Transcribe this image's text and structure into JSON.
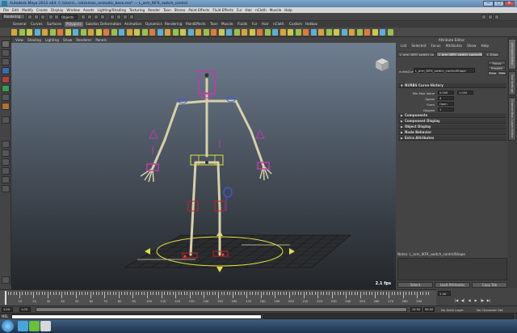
{
  "window": {
    "title": "Autodesk Maya 2012 x64: C:\\Users\\...\\stickman_animatic_base.ma* --- L_arm_IKFK_switch_control",
    "min_glyph": "—",
    "max_glyph": "□",
    "close_glyph": "✕"
  },
  "menubar": [
    "File",
    "Edit",
    "Modify",
    "Create",
    "Display",
    "Window",
    "Assets",
    "Lighting/Shading",
    "Texturing",
    "Render",
    "Toon",
    "Stereo",
    "Paint Effects",
    "Fluid Effects",
    "Fur",
    "Hair",
    "nCloth",
    "Muscle",
    "Help"
  ],
  "status_line": {
    "mode": "Rendering",
    "objects_field": "Objects"
  },
  "shelf": {
    "tabs": [
      "General",
      "Curves",
      "Surfaces",
      "Polygons",
      "Subdivs",
      "Deformation",
      "Animation",
      "Dynamics",
      "Rendering",
      "PaintEffects",
      "Toon",
      "Muscle",
      "Fluids",
      "Fur",
      "Hair",
      "nCloth",
      "Custom",
      "Hotbox"
    ],
    "active_tab": "Polygons",
    "icon_colors": [
      "#d9a33a",
      "#9ac24a",
      "#c9c94a",
      "#5bb0d6",
      "#d9a33a",
      "#9ac24a",
      "#e07a3a",
      "#c9c94a",
      "#5bb0d6",
      "#9ac24a",
      "#d9a33a",
      "#c9c94a",
      "#e07a3a",
      "#9ac24a",
      "#5bb0d6",
      "#d9a33a",
      "#c9c94a",
      "#9ac24a",
      "#e07a3a",
      "#5bb0d6",
      "#d9a33a",
      "#9ac24a",
      "#c9c94a",
      "#5bb0d6",
      "#d9a33a",
      "#9ac24a",
      "#e07a3a",
      "#c9c94a",
      "#5bb0d6",
      "#9ac24a",
      "#d9a33a",
      "#c9c94a",
      "#e07a3a",
      "#9ac24a",
      "#5bb0d6",
      "#d9a33a",
      "#c9c94a",
      "#9ac24a",
      "#e07a3a",
      "#5bb0d6",
      "#d9a33a",
      "#9ac24a",
      "#c9c94a",
      "#5bb0d6",
      "#d9a33a",
      "#9ac24a",
      "#e07a3a",
      "#c9c94a",
      "#5bb0d6",
      "#9ac24a"
    ]
  },
  "viewport": {
    "menu": [
      "View",
      "Shading",
      "Lighting",
      "Show",
      "Renderer",
      "Panels"
    ],
    "fps": "2.1 fps",
    "background_top": "#6f7f91",
    "background_bottom": "#232629",
    "bone_color": "#d8d0a8",
    "control_magenta": "#c03ab0",
    "control_blue": "#4455ee",
    "control_yellow": "#e0e040",
    "control_red": "#d02020"
  },
  "attribute_editor": {
    "title": "Attribute Editor",
    "menu": [
      "List",
      "Selected",
      "Focus",
      "Attributes",
      "Show",
      "Help"
    ],
    "tabs": [
      "L_arm_IKFK_switch_control",
      "L_arm_IKFK_switch_controlShape",
      "L_Elbow"
    ],
    "active_tab": "L_arm_IKFK_switch_controlShape",
    "focus_label": "Focus",
    "presets_label": "Presets",
    "show_label": "Show",
    "hide_label": "Hide",
    "node_type_label": "nurbsCurve:",
    "node_name": "L_arm_IKFK_switch_controlShape",
    "sections": {
      "curve_history": "NURBS Curve History",
      "components": "Components",
      "component_display": "Component Display",
      "object_display": "Object Display",
      "node_behavior": "Node Behavior",
      "extra_attributes": "Extra Attributes"
    },
    "attrs": {
      "min_max_label": "Min Max Value",
      "min_value": "0.000",
      "max_value": "1.000",
      "spans_label": "Spans",
      "spans_value": "4",
      "form_label": "Form",
      "form_value": "Open",
      "degree_label": "Degree",
      "degree_value": "1"
    },
    "notes_label": "Notes: L_arm_IKFK_switch_controlShape",
    "buttons": {
      "select": "Select",
      "load_attributes": "Load Attributes",
      "copy_tab": "Copy Tab"
    }
  },
  "side_tabs": [
    "Attribute Editor",
    "Tool Settings",
    "Channel Box / Layer Editor"
  ],
  "time_slider": {
    "ticks": [
      "1",
      "10",
      "20",
      "30",
      "40",
      "50",
      "60",
      "70",
      "80",
      "90",
      "100",
      "110",
      "120",
      "130",
      "140",
      "150",
      "160",
      "170",
      "180",
      "190",
      "200",
      "210",
      "220",
      "230",
      "240",
      "250",
      "260",
      "270",
      "280",
      "290"
    ],
    "current_time": "1.00",
    "playback_glyphs": [
      "|◀",
      "◀|",
      "◀",
      "▶",
      "|▶",
      "▶|"
    ]
  },
  "range_slider": {
    "start": "1.00",
    "inner_start": "1.00",
    "inner_end": "24.00",
    "end": "96.00",
    "anim_layer": "No Anim Layer",
    "character_set": "No Character Set"
  },
  "command_line": {
    "language": "MEL"
  },
  "taskbar": {
    "icon_colors": [
      "#4aa3df",
      "#6bbf3a",
      "#d8d8d8"
    ]
  }
}
